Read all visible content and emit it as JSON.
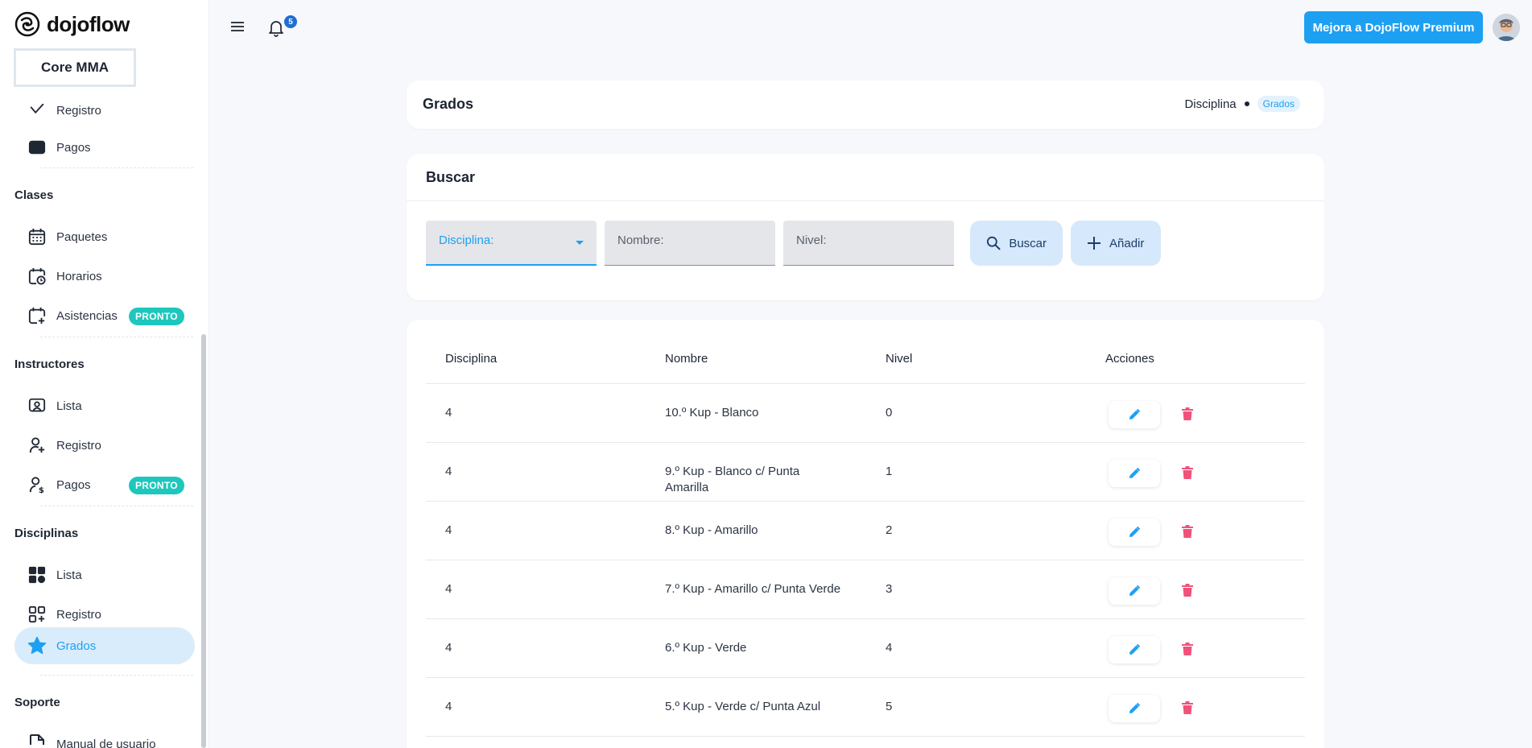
{
  "brand": {
    "name": "dojoflow"
  },
  "org": {
    "name": "Core MMA"
  },
  "sidebar": {
    "items": [
      {
        "label": "Registro",
        "icon": "check-icon"
      },
      {
        "label": "Pagos",
        "icon": "card-icon"
      },
      {
        "section": "Clases"
      },
      {
        "label": "Paquetes",
        "icon": "calendar-grid-icon"
      },
      {
        "label": "Horarios",
        "icon": "calendar-clock-icon"
      },
      {
        "label": "Asistencias",
        "icon": "calendar-plus-icon",
        "badge": "PRONTO"
      },
      {
        "section": "Instructores"
      },
      {
        "label": "Lista",
        "icon": "user-screen-icon"
      },
      {
        "label": "Registro",
        "icon": "user-plus-icon"
      },
      {
        "label": "Pagos",
        "icon": "user-dollar-icon",
        "badge": "PRONTO"
      },
      {
        "section": "Disciplinas"
      },
      {
        "label": "Lista",
        "icon": "grid-icon"
      },
      {
        "label": "Registro",
        "icon": "grid-plus-icon"
      },
      {
        "label": "Grados",
        "icon": "star-icon",
        "active": true
      },
      {
        "section": "Soporte"
      },
      {
        "label": "Manual de usuario",
        "icon": "doc-icon"
      }
    ]
  },
  "topbar": {
    "notifications": "5",
    "premium_label": "Mejora a DojoFlow Premium"
  },
  "page": {
    "title": "Grados",
    "breadcrumb": {
      "parent": "Disciplina",
      "current": "Grados"
    }
  },
  "search": {
    "header": "Buscar",
    "fields": {
      "disciplina": "Disciplina:",
      "nombre": "Nombre:",
      "nivel": "Nivel:"
    },
    "buscar_label": "Buscar",
    "anadir_label": "Añadir"
  },
  "table": {
    "headers": [
      "Disciplina",
      "Nombre",
      "Nivel",
      "Acciones"
    ],
    "rows": [
      {
        "disciplina": "4",
        "nombre": "10.º Kup - Blanco",
        "nivel": "0"
      },
      {
        "disciplina": "4",
        "nombre": "9.º Kup - Blanco c/ Punta Amarilla",
        "nivel": "1"
      },
      {
        "disciplina": "4",
        "nombre": "8.º Kup - Amarillo",
        "nivel": "2"
      },
      {
        "disciplina": "4",
        "nombre": "7.º Kup - Amarillo c/ Punta Verde",
        "nivel": "3"
      },
      {
        "disciplina": "4",
        "nombre": "6.º Kup - Verde",
        "nivel": "4"
      },
      {
        "disciplina": "4",
        "nombre": "5.º Kup - Verde c/ Punta Azul",
        "nivel": "5"
      }
    ]
  },
  "colors": {
    "accent": "#1da0f2",
    "badge": "#1ec7bd",
    "delete": "#f0527a"
  }
}
